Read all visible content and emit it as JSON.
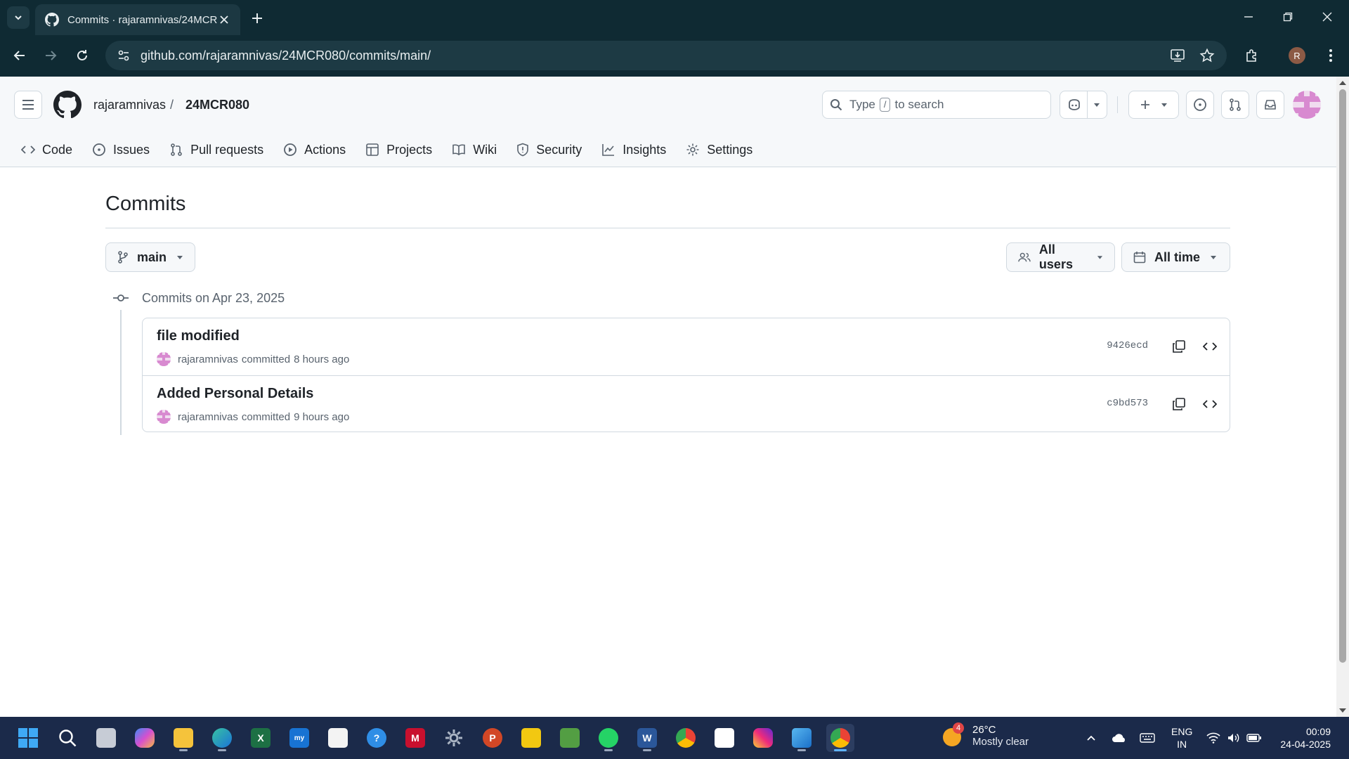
{
  "browser": {
    "tab_title": "Commits · rajaramnivas/24MCR080",
    "url": "github.com/rajaramnivas/24MCR080/commits/main/",
    "profile_initial": "R"
  },
  "header": {
    "owner": "rajaramnivas",
    "separator": "/",
    "repo": "24MCR080",
    "search_prefix": "Type",
    "search_key": "/",
    "search_suffix": "to search"
  },
  "repo_nav": [
    {
      "label": "Code",
      "icon": "code-icon"
    },
    {
      "label": "Issues",
      "icon": "issue-opened-icon"
    },
    {
      "label": "Pull requests",
      "icon": "git-pull-request-icon"
    },
    {
      "label": "Actions",
      "icon": "play-icon"
    },
    {
      "label": "Projects",
      "icon": "table-icon"
    },
    {
      "label": "Wiki",
      "icon": "book-icon"
    },
    {
      "label": "Security",
      "icon": "shield-icon"
    },
    {
      "label": "Insights",
      "icon": "graph-icon"
    },
    {
      "label": "Settings",
      "icon": "gear-icon"
    }
  ],
  "main": {
    "title": "Commits",
    "branch": "main",
    "users_filter": "All users",
    "time_filter": "All time",
    "group_label": "Commits on Apr 23, 2025",
    "commits": [
      {
        "message": "file modified",
        "author": "rajaramnivas",
        "action": "committed",
        "when": "8 hours ago",
        "sha": "9426ecd"
      },
      {
        "message": "Added Personal Details",
        "author": "rajaramnivas",
        "action": "committed",
        "when": "9 hours ago",
        "sha": "c9bd573"
      }
    ]
  },
  "taskbar": {
    "weather_badge": "4",
    "temperature": "26°C",
    "condition": "Mostly clear",
    "lang_line1": "ENG",
    "lang_line2": "IN",
    "time": "00:09",
    "date": "24-04-2025"
  },
  "colors": {
    "chrome_bg": "#0f2a33",
    "page_bg": "#ffffff",
    "header_bg": "#f6f8fa",
    "border": "#d1d9e0",
    "text": "#1f2328",
    "muted": "#59636e",
    "taskbar_bg": "#1b2a4a"
  }
}
